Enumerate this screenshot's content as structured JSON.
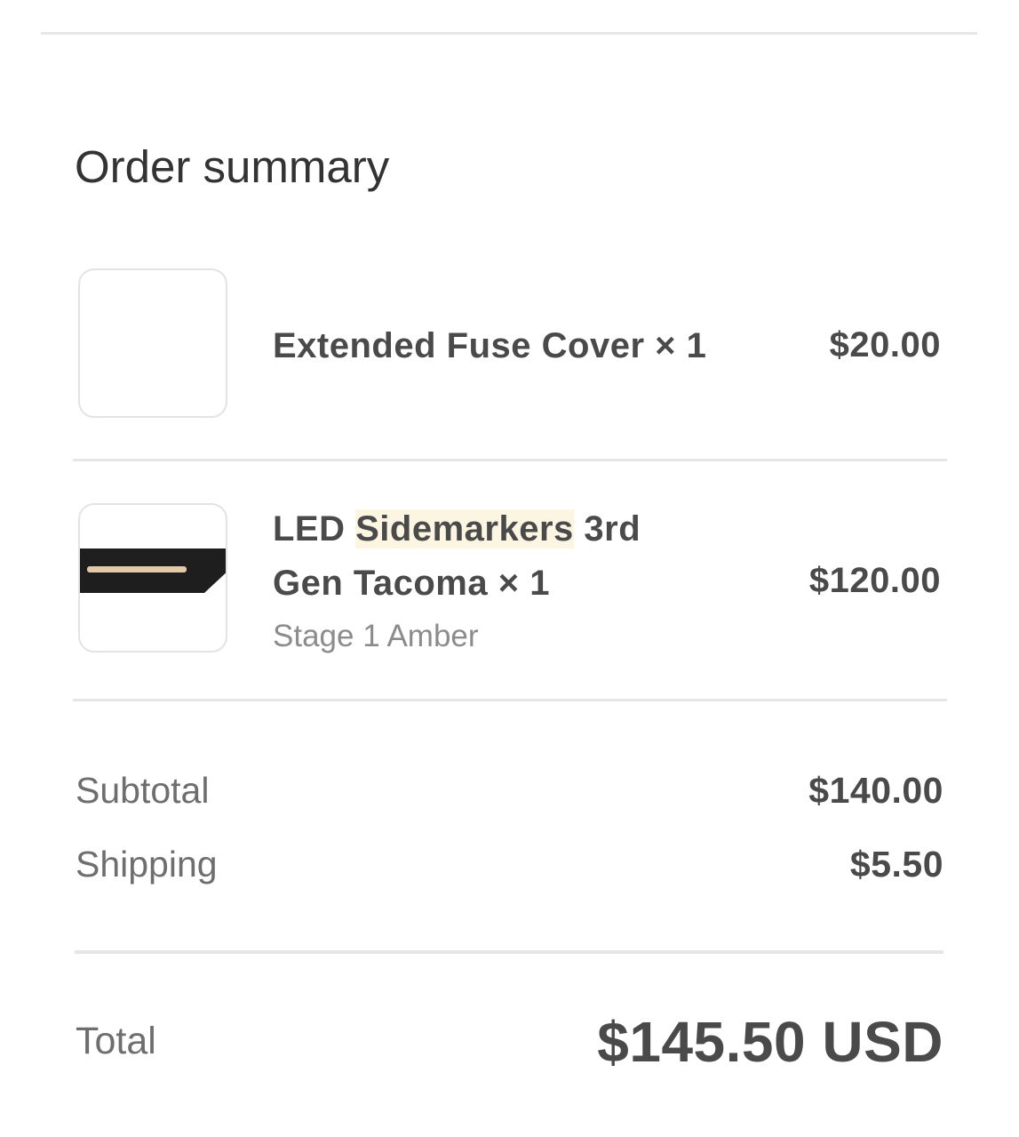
{
  "summary": {
    "title": "Order summary"
  },
  "items": [
    {
      "name": "Extended Fuse Cover × 1",
      "price": "$20.00",
      "thumbnail": "blank-product-image"
    },
    {
      "name_before": "LED ",
      "name_highlight": "Sidemarkers",
      "name_line1_after": " 3rd",
      "name_line2": "Gen Tacoma × 1",
      "variant": "Stage 1 Amber",
      "price": "$120.00",
      "thumbnail": "sidemarker-product-image"
    }
  ],
  "totals": {
    "subtotal_label": "Subtotal",
    "subtotal_value": "$140.00",
    "shipping_label": "Shipping",
    "shipping_value": "$5.50",
    "total_label": "Total",
    "total_value": "$145.50 USD"
  },
  "colors": {
    "highlight": "#fbf5e2",
    "text_primary": "#4a4a4a",
    "text_secondary": "#6e6e6e",
    "divider": "#e6e6e6"
  }
}
